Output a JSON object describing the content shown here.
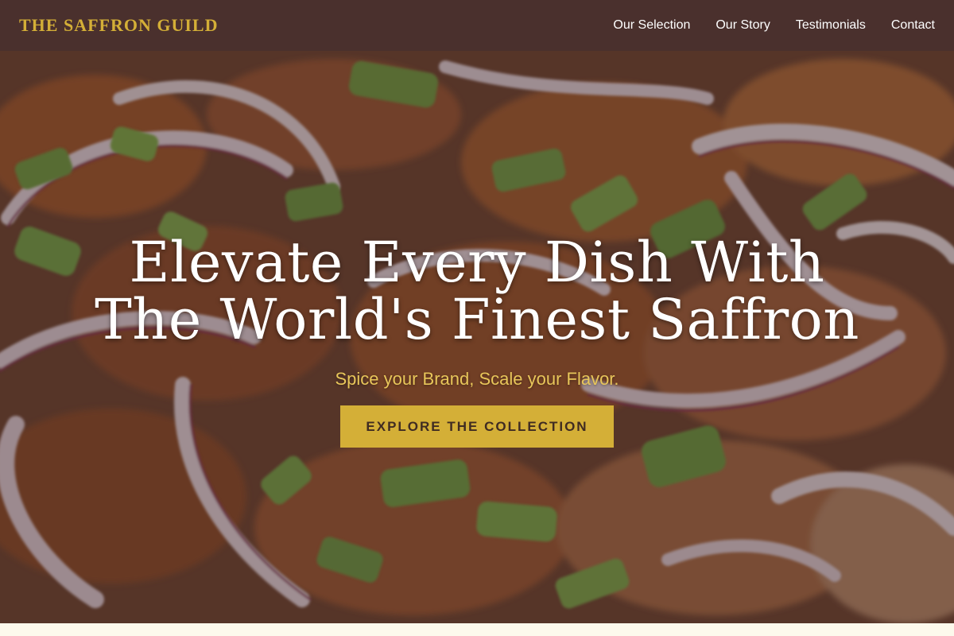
{
  "header": {
    "brand": "THE SAFFRON GUILD",
    "nav": [
      "Our Selection",
      "Our Story",
      "Testimonials",
      "Contact"
    ]
  },
  "hero": {
    "title_line1": "Elevate Every Dish With",
    "title_line2": "The World's Finest Saffron",
    "subtitle": "Spice your Brand, Scale your Flavor.",
    "cta": "EXPLORE THE COLLECTION"
  },
  "colors": {
    "header_bg": "#4a302d",
    "accent_gold": "#d4af37",
    "page_bg": "#fdf9ec"
  }
}
